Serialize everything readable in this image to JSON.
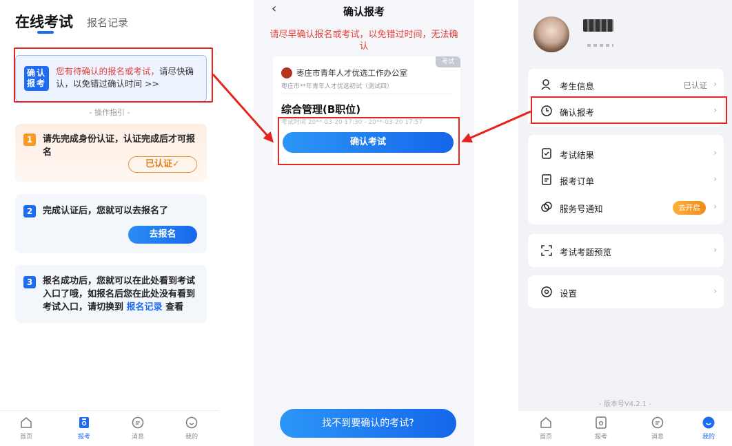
{
  "left_screen": {
    "title": "在线考试",
    "tab_records": "报名记录",
    "pending_badge": "确认\n报考",
    "pending_text_red": "您有待确认的报名或考试，",
    "pending_text_rest": "请尽快确认，以免错过确认时间 >>",
    "guide": "- 操作指引 -",
    "step1": {
      "num": "1",
      "text": "请先完成身份认证，认证完成后才可报名",
      "button": "已认证✓"
    },
    "step2": {
      "num": "2",
      "text": "完成认证后，您就可以去报名了",
      "button": "去报名"
    },
    "step3": {
      "num": "3",
      "text_before": "报名成功后，您就可以在此处看到考试入口了哦，如报名后您在此处没有看到考试入口，请切换到 ",
      "link": "报名记录",
      "text_after": " 查看"
    },
    "tabs": [
      {
        "label": "首页",
        "icon": "home-icon"
      },
      {
        "label": "报考",
        "icon": "apply-icon"
      },
      {
        "label": "消息",
        "icon": "message-icon"
      },
      {
        "label": "我的",
        "icon": "profile-icon"
      }
    ]
  },
  "middle_screen": {
    "back": "‹",
    "title": "确认报考",
    "warning": "请尽早确认报名或考试，以免错过时间，无法确认",
    "card": {
      "tag": "考试",
      "org": "枣庄市青年人才优选工作办公室",
      "sub": "枣庄市**年青年人才优选初试（测试四）",
      "exam_name": "综合管理(B职位)",
      "time": "考试时间 20**-03-20 17:30 - 20**-03-20 17:57",
      "button": "确认考试"
    },
    "not_found": "找不到要确认的考试?"
  },
  "right_screen": {
    "menu_group1": [
      {
        "label": "考生信息",
        "value": "已认证",
        "icon": "person-icon"
      },
      {
        "label": "确认报考",
        "value": "",
        "icon": "clock-icon"
      }
    ],
    "menu_group2": [
      {
        "label": "考试结果",
        "icon": "clipboard-icon"
      },
      {
        "label": "报考订单",
        "icon": "order-icon"
      },
      {
        "label": "服务号通知",
        "badge": "去开启",
        "icon": "notify-icon"
      }
    ],
    "menu_group3": [
      {
        "label": "考试考题预览",
        "icon": "preview-icon"
      }
    ],
    "menu_group4": [
      {
        "label": "设置",
        "icon": "settings-icon"
      }
    ],
    "version": "- 版本号V4.2.1 -",
    "tabs": [
      {
        "label": "首页",
        "icon": "home-icon"
      },
      {
        "label": "报考",
        "icon": "apply-icon"
      },
      {
        "label": "消息",
        "icon": "message-icon"
      },
      {
        "label": "我的",
        "icon": "profile-icon"
      }
    ],
    "chevron": "›"
  },
  "colors": {
    "primary": "#1d6cf2",
    "alert": "#e4413b",
    "annotation_red": "#e5241d",
    "orange": "#f28a1a"
  }
}
